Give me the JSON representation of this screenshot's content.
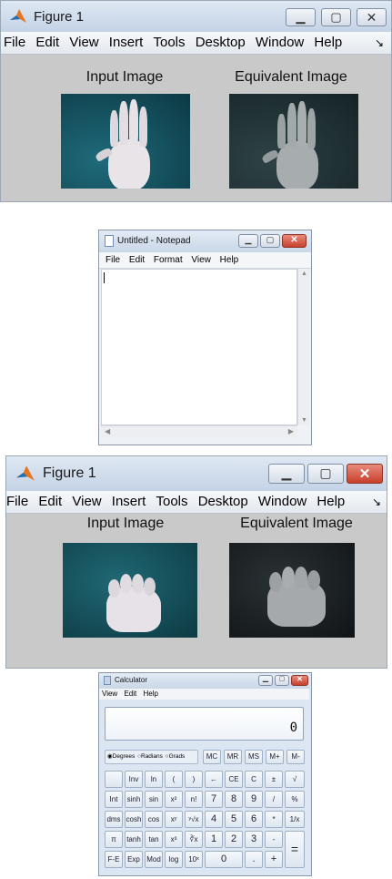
{
  "figure1": {
    "title": "Figure 1",
    "menu": [
      "File",
      "Edit",
      "View",
      "Insert",
      "Tools",
      "Desktop",
      "Window",
      "Help"
    ],
    "left_caption": "Input Image",
    "right_caption": "Equivalent Image"
  },
  "notepad": {
    "title": "Untitled - Notepad",
    "menu": [
      "File",
      "Edit",
      "Format",
      "View",
      "Help"
    ],
    "content": ""
  },
  "figure2": {
    "title": "Figure 1",
    "menu": [
      "File",
      "Edit",
      "View",
      "Insert",
      "Tools",
      "Desktop",
      "Window",
      "Help"
    ],
    "left_caption": "Input Image",
    "right_caption": "Equivalent Image"
  },
  "calculator": {
    "title": "Calculator",
    "menu": [
      "View",
      "Edit",
      "Help"
    ],
    "display": "0",
    "angle_modes": [
      "Degrees",
      "Radians",
      "Grads"
    ],
    "selected_mode": "Degrees",
    "memory_keys": [
      "MC",
      "MR",
      "MS",
      "M+",
      "M-"
    ],
    "rows": [
      [
        "",
        "Inv",
        "ln",
        "(",
        ")",
        "←",
        "CE",
        "C",
        "±",
        "√"
      ],
      [
        "Int",
        "sinh",
        "sin",
        "x²",
        "n!",
        "7",
        "8",
        "9",
        "/",
        "%"
      ],
      [
        "dms",
        "cosh",
        "cos",
        "xʸ",
        "ʸ√x",
        "4",
        "5",
        "6",
        "*",
        "1/x"
      ],
      [
        "π",
        "tanh",
        "tan",
        "x³",
        "∛x",
        "1",
        "2",
        "3",
        "-",
        "="
      ],
      [
        "F-E",
        "Exp",
        "Mod",
        "log",
        "10ˣ",
        "0",
        ".",
        "+"
      ]
    ]
  }
}
